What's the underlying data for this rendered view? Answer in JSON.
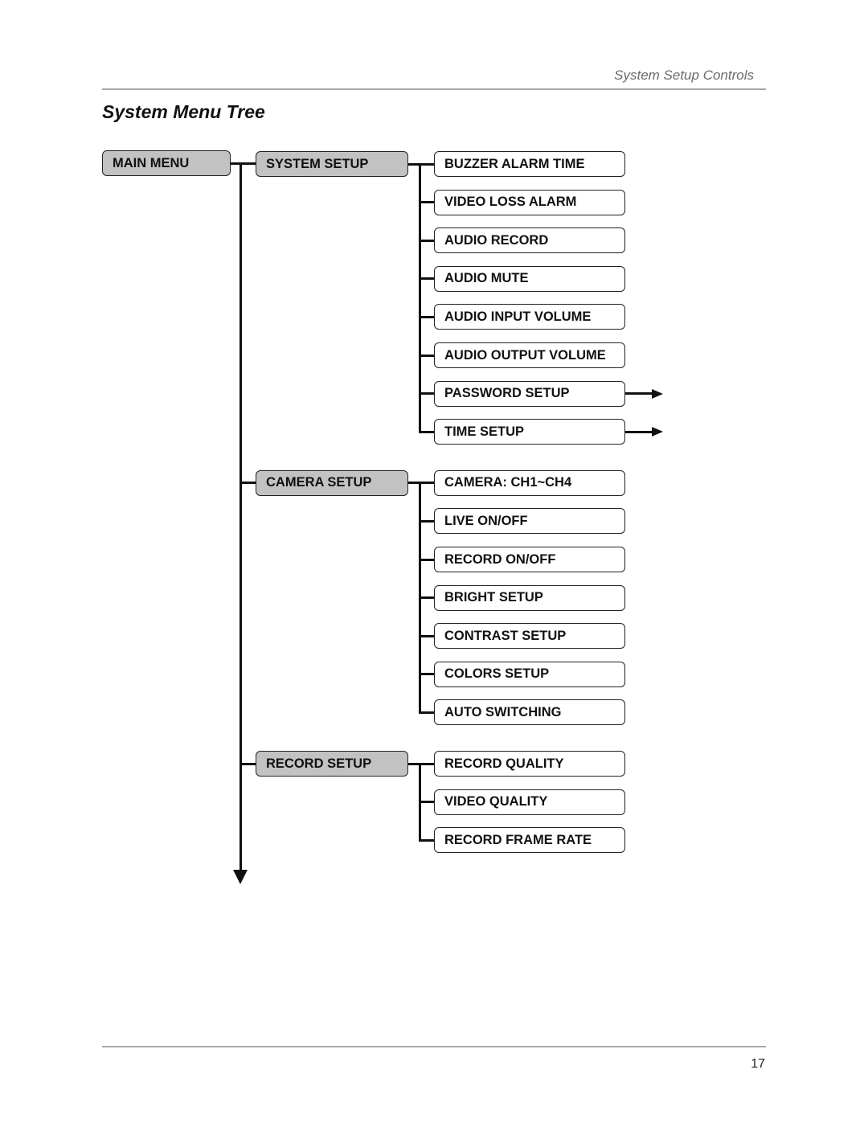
{
  "header": {
    "running_head": "System Setup Controls",
    "title": "System Menu Tree"
  },
  "tree": {
    "root": "MAIN MENU",
    "groups": [
      {
        "label": "SYSTEM SETUP",
        "items": [
          {
            "label": "BUZZER ALARM TIME",
            "has_submenu_arrow": false
          },
          {
            "label": "VIDEO LOSS ALARM",
            "has_submenu_arrow": false
          },
          {
            "label": "AUDIO RECORD",
            "has_submenu_arrow": false
          },
          {
            "label": "AUDIO MUTE",
            "has_submenu_arrow": false
          },
          {
            "label": "AUDIO INPUT VOLUME",
            "has_submenu_arrow": false
          },
          {
            "label": "AUDIO OUTPUT VOLUME",
            "has_submenu_arrow": false
          },
          {
            "label": "PASSWORD SETUP",
            "has_submenu_arrow": true
          },
          {
            "label": "TIME SETUP",
            "has_submenu_arrow": true
          }
        ]
      },
      {
        "label": "CAMERA SETUP",
        "items": [
          {
            "label": "CAMERA: CH1~CH4",
            "has_submenu_arrow": false
          },
          {
            "label": "LIVE ON/OFF",
            "has_submenu_arrow": false
          },
          {
            "label": "RECORD ON/OFF",
            "has_submenu_arrow": false
          },
          {
            "label": "BRIGHT SETUP",
            "has_submenu_arrow": false
          },
          {
            "label": "CONTRAST SETUP",
            "has_submenu_arrow": false
          },
          {
            "label": "COLORS SETUP",
            "has_submenu_arrow": false
          },
          {
            "label": "AUTO SWITCHING",
            "has_submenu_arrow": false
          }
        ]
      },
      {
        "label": "RECORD SETUP",
        "items": [
          {
            "label": "RECORD QUALITY",
            "has_submenu_arrow": false
          },
          {
            "label": "VIDEO QUALITY",
            "has_submenu_arrow": false
          },
          {
            "label": "RECORD FRAME RATE",
            "has_submenu_arrow": false
          }
        ]
      }
    ],
    "continues_below": true
  },
  "footer": {
    "page_number": "17"
  }
}
